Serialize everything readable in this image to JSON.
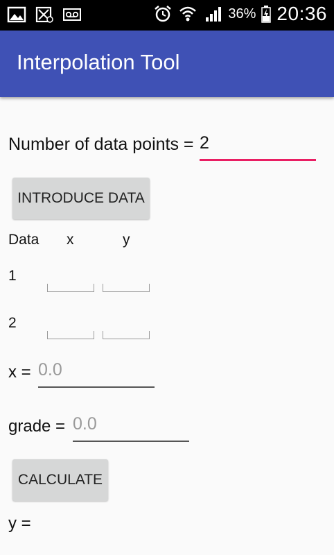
{
  "status_bar": {
    "icons_left": [
      "image-icon",
      "no-sim-icon",
      "voicemail-icon"
    ],
    "icons_right": [
      "alarm-icon",
      "wifi-icon",
      "signal-icon",
      "battery-icon"
    ],
    "battery_percent": "36%",
    "time": "20:36"
  },
  "app_bar": {
    "title": "Interpolation Tool"
  },
  "form": {
    "num_points_label": "Number of data points =",
    "num_points_value": "2",
    "introduce_button": "INTRODUCE DATA",
    "table_headers": {
      "data": "Data",
      "x": "x",
      "y": "y"
    },
    "rows": [
      {
        "index": "1",
        "x": "",
        "y": ""
      },
      {
        "index": "2",
        "x": "",
        "y": ""
      }
    ],
    "x_label": "x =",
    "x_placeholder": "0.0",
    "grade_label": "grade =",
    "grade_placeholder": "0.0",
    "calculate_button": "CALCULATE",
    "y_result_label": "y ="
  }
}
